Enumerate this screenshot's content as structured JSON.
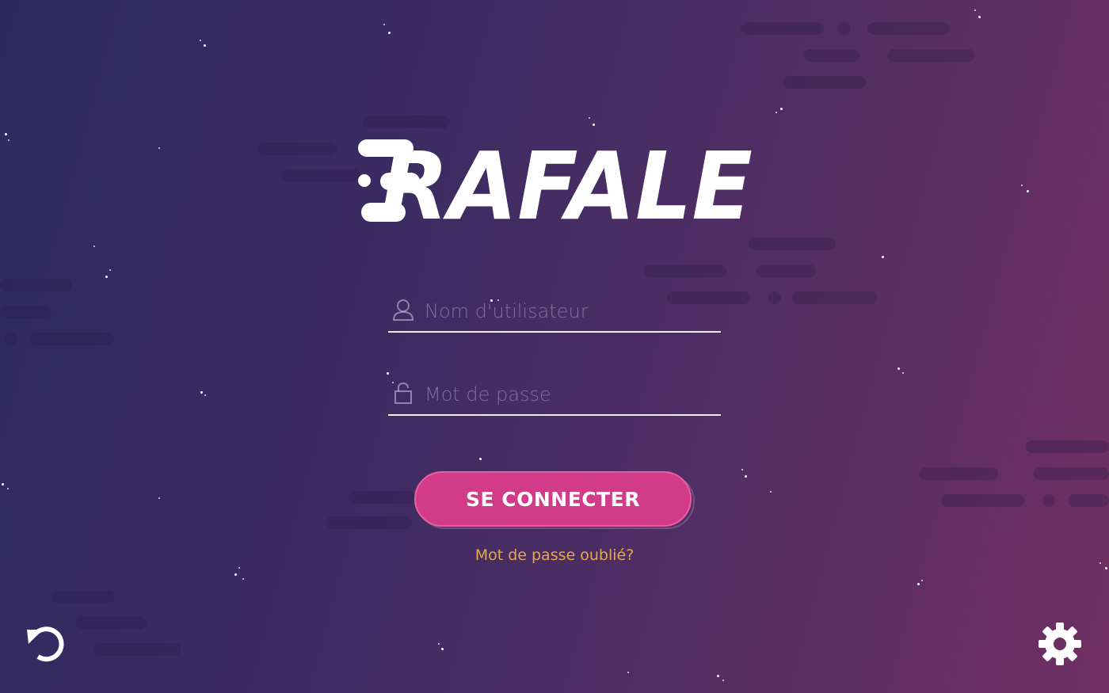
{
  "app": {
    "logo_text": "RAFALE"
  },
  "login": {
    "username_placeholder": "Nom d'utilisateur",
    "username_value": "",
    "password_placeholder": "Mot de passe",
    "password_value": "",
    "submit_label": "SE CONNECTER",
    "forgot_label": "Mot de passe oublié?"
  },
  "icons": {
    "username": "user-icon",
    "password": "lock-icon",
    "back": "undo-icon",
    "settings": "gear-icon"
  },
  "colors": {
    "button": "#d23a8a",
    "forgot_link": "#e6a84a",
    "background_start": "#2e2a5f",
    "background_end": "#702f63"
  }
}
